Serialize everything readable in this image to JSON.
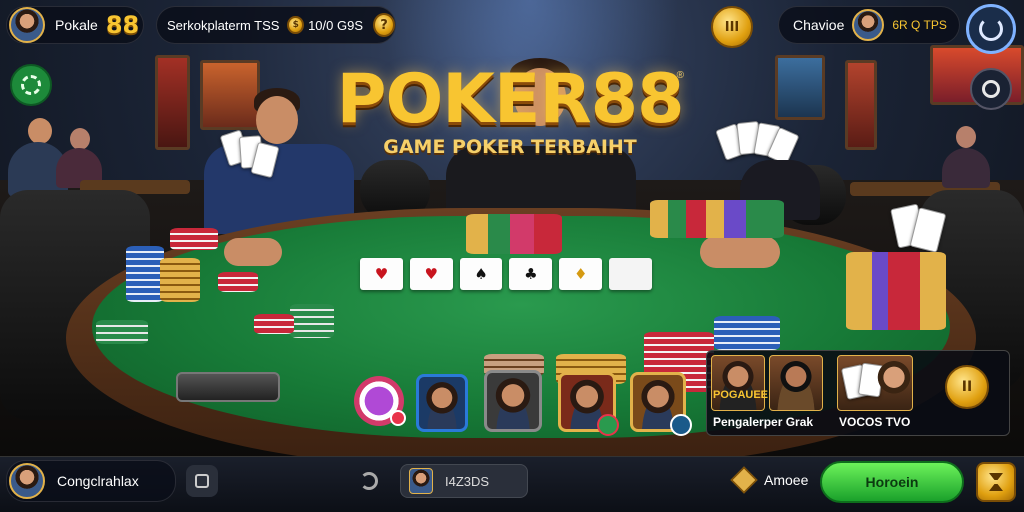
{
  "header": {
    "player_name": "Pokale",
    "player_level": "88",
    "room_info": "Serkokplaterm TSS",
    "chip_amount": "10/0 G9S",
    "help_icon": "?",
    "coin_icon": "III",
    "opponent_name": "Chavioe",
    "opponent_stats": "6R Q TPS"
  },
  "logo": {
    "title": "POKER88",
    "subtitle": "GAME POKER TERBAIHT",
    "registered_mark": "®"
  },
  "community_cards": [
    {
      "symbol": "♥",
      "color": "red"
    },
    {
      "symbol": "♥",
      "color": "red"
    },
    {
      "symbol": "♠",
      "color": "black"
    },
    {
      "symbol": "♣",
      "color": "black"
    },
    {
      "symbol": "♦",
      "color": "gold"
    },
    {
      "symbol": "",
      "color": "blank"
    }
  ],
  "players_panel": {
    "top_label": "POGAUEE",
    "bottom_label": "Pengalerper Grak",
    "right_label": "VOCOS TVO",
    "pause_icon": "II"
  },
  "bottom_bar": {
    "user_name": "Congclrahlax",
    "balance": "I4Z3DS",
    "action_label": "Amoee",
    "primary_button": "Horoein"
  },
  "icons": {
    "recycle": "recycle-icon",
    "refresh": "refresh-icon",
    "settings": "ring-icon",
    "menu_back": "back-icon",
    "sync": "sync-icon",
    "speaker": "speaker-icon",
    "hourglass": "hourglass-icon"
  },
  "colors": {
    "felt": "#177a37",
    "gold": "#f8c531",
    "accent_green": "#1aa12b"
  }
}
